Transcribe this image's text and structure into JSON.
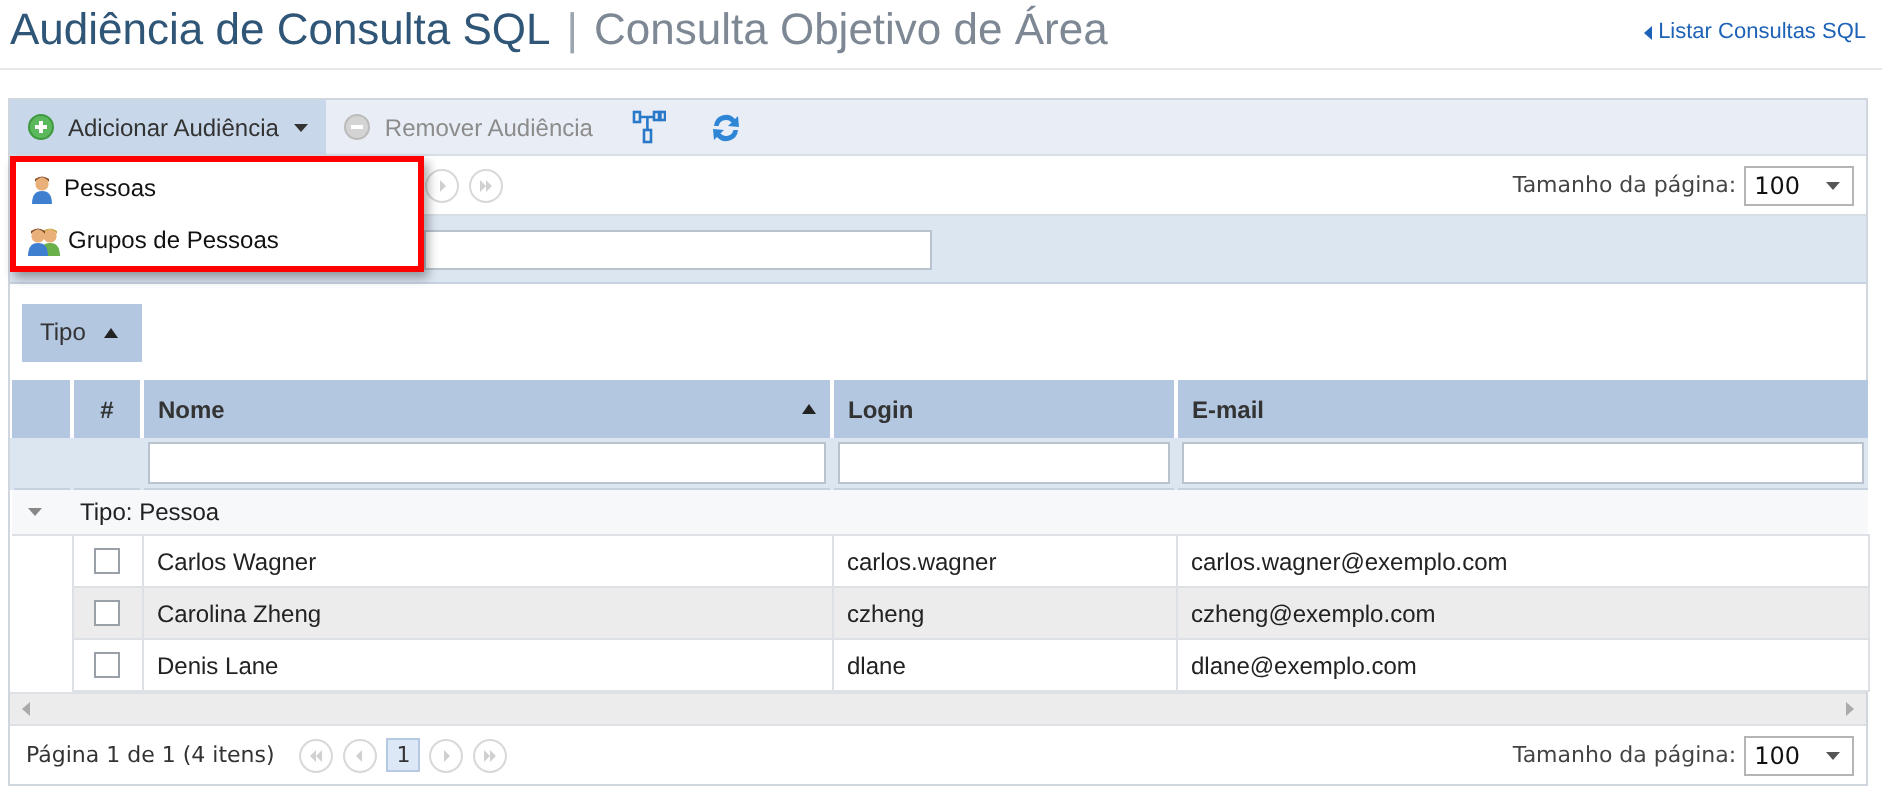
{
  "header": {
    "title": "Audiência de Consulta SQL",
    "separator": "|",
    "subtitle": "Consulta Objetivo de Área",
    "back_link": "Listar Consultas SQL"
  },
  "toolbar": {
    "items": [
      {
        "kind": "add",
        "label": "Adicionar Audiência",
        "disabled": false,
        "expanded": true
      },
      {
        "kind": "remove",
        "label": "Remover Audiência",
        "disabled": true,
        "expanded": false
      },
      {
        "kind": "hierarchy",
        "disabled": false,
        "expanded": false
      },
      {
        "kind": "refresh",
        "disabled": false,
        "expanded": false
      }
    ]
  },
  "menu": {
    "items": [
      {
        "kind": "person",
        "label": "Pessoas"
      },
      {
        "kind": "group",
        "label": "Grupos de Pessoas"
      }
    ]
  },
  "top_pager": {
    "page_size_label": "Tamanho da página:",
    "page_size": "100"
  },
  "group_panel": {
    "chips": [
      {
        "label": "Tipo",
        "sorted_ascending": true
      }
    ]
  },
  "table": {
    "columns": [
      {
        "label": "#",
        "sorted_ascending": false
      },
      {
        "label": "Nome",
        "sorted_ascending": true
      },
      {
        "label": "Login",
        "sorted_ascending": false
      },
      {
        "label": "E-mail",
        "sorted_ascending": false
      }
    ],
    "groups": [
      {
        "label": "Tipo: Pessoa",
        "expanded": true,
        "rows": [
          {
            "checked": false,
            "cells": [
              "Carlos Wagner",
              "carlos.wagner",
              "carlos.wagner@exemplo.com"
            ]
          },
          {
            "checked": false,
            "cells": [
              "Carolina Zheng",
              "czheng",
              "czheng@exemplo.com"
            ]
          },
          {
            "checked": false,
            "cells": [
              "Denis Lane",
              "dlane",
              "dlane@exemplo.com"
            ]
          }
        ]
      }
    ]
  },
  "bottom_pager": {
    "summary": "Página 1 de 1 (4 itens)",
    "pages": [
      {
        "label": "1",
        "selected": true
      }
    ],
    "page_size_label": "Tamanho da página:",
    "page_size": "100"
  }
}
